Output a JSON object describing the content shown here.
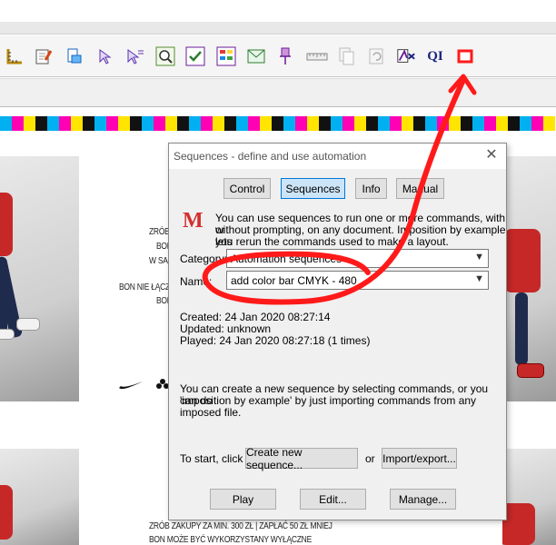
{
  "toolbar": {
    "icons": [
      "ruler-icon",
      "edit-note-icon",
      "print-setup-icon",
      "pointer-icon",
      "pointer-select-icon",
      "zoom-page-icon",
      "check-icon",
      "layout-icon",
      "envelope-icon",
      "pin-icon",
      "scale-icon",
      "copy-icon",
      "rotate-icon",
      "imposition-icon",
      "qi-icon",
      "automation-icon"
    ],
    "qi_label": "QI"
  },
  "colorbar": [
    "#00b0f0",
    "#ff00b4",
    "#ffe500",
    "#111111",
    "#00b0f0",
    "#ff00b4",
    "#ffe500",
    "#111111",
    "#00b0f0",
    "#ff00b4",
    "#ffe500",
    "#111111",
    "#00b0f0",
    "#ff00b4",
    "#ffe500",
    "#111111",
    "#00b0f0",
    "#ff00b4",
    "#ffe500",
    "#111111",
    "#00b0f0",
    "#ff00b4",
    "#ffe500",
    "#111111",
    "#00b0f0",
    "#ff00b4",
    "#ffe500",
    "#111111",
    "#00b0f0",
    "#ff00b4",
    "#ffe500",
    "#111111",
    "#00b0f0",
    "#ff00b4",
    "#ffe500",
    "#111111",
    "#00b0f0",
    "#ff00b4",
    "#ffe500",
    "#111111",
    "#00b0f0",
    "#ff00b4",
    "#ffe500",
    "#111111",
    "#00b0f0",
    "#ff00b4",
    "#ffe500"
  ],
  "document": {
    "left_texts": [
      "ZRÓB",
      "BON",
      "W SA",
      "BON NIE ŁĄCZY",
      "BON"
    ],
    "bottom_line_1": "ZRÓB ZAKUPY ZA MIN. 300 ZŁ | ZAPŁAĆ 50 ZŁ MNIEJ",
    "bottom_line_2": "BON MOŻE BYĆ WYKORZYSTANY WYŁĄCZNE",
    "logo_1": "NIKE",
    "logo_2": "adidas"
  },
  "dialog": {
    "title": "Sequences - define and use automation",
    "close_glyph": "✕",
    "tabs": [
      "Control",
      "Sequences",
      "Info",
      "Manual"
    ],
    "logo_letter": "M",
    "intro": [
      "You can use sequences to run one or more commands, with or",
      "without prompting, on any document. Imposition by example lets",
      "you rerun the commands used to make a layout."
    ],
    "category_label": "Category:",
    "category_value": "Automation sequences",
    "name_label": "Name:",
    "name_value": "add color bar CMYK - 480",
    "created": "Created: 24 Jan 2020 08:27:14",
    "updated": "Updated: unknown",
    "played": "Played: 24 Jan 2020 08:27:18 (1 times)",
    "help": [
      "You can create a new sequence by selecting commands, or you can do",
      "'imposition by example' by just importing commands from any imposed file."
    ],
    "start_label": "To start, click",
    "create_button": "Create new sequence...",
    "or_label": "or",
    "import_button": "Import/export...",
    "play_button": "Play",
    "edit_button": "Edit...",
    "manage_button": "Manage..."
  },
  "annotation_color": "#ff1a1a"
}
